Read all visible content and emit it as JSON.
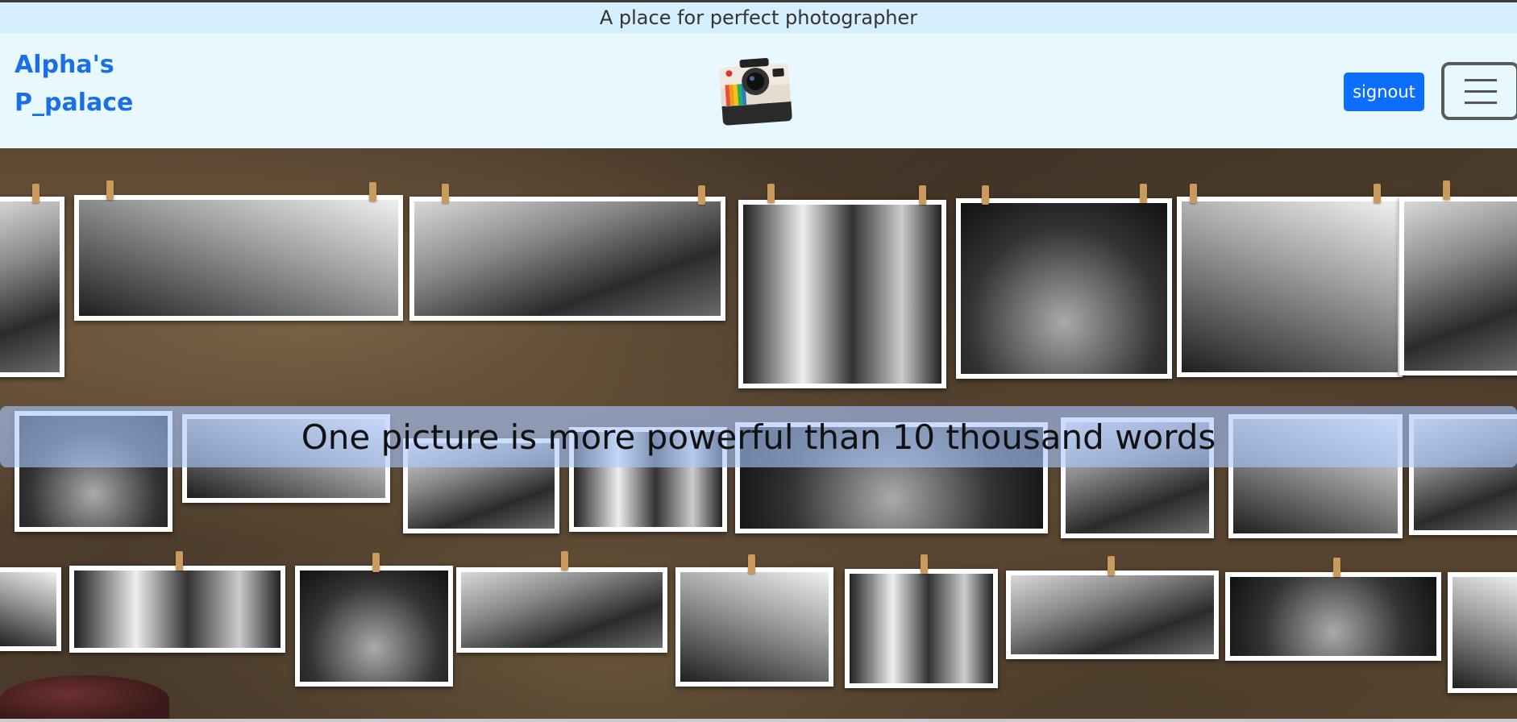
{
  "header": {
    "tagline": "A place for perfect photographer",
    "brand_line1": "Alpha's",
    "brand_line2": "P_palace",
    "signout_label": "signout"
  },
  "hero": {
    "quote": "One picture is more powerful than 10 thousand words"
  },
  "colors": {
    "brand_blue": "#1a6fe8",
    "button_blue": "#0d6efd",
    "navbar_bg": "#e7f9ff",
    "tagline_bg": "#d6efff",
    "quote_band": "rgba(170,200,255,0.62)"
  },
  "icons": {
    "logo": "instant-camera-icon",
    "menu": "hamburger-menu-icon"
  }
}
